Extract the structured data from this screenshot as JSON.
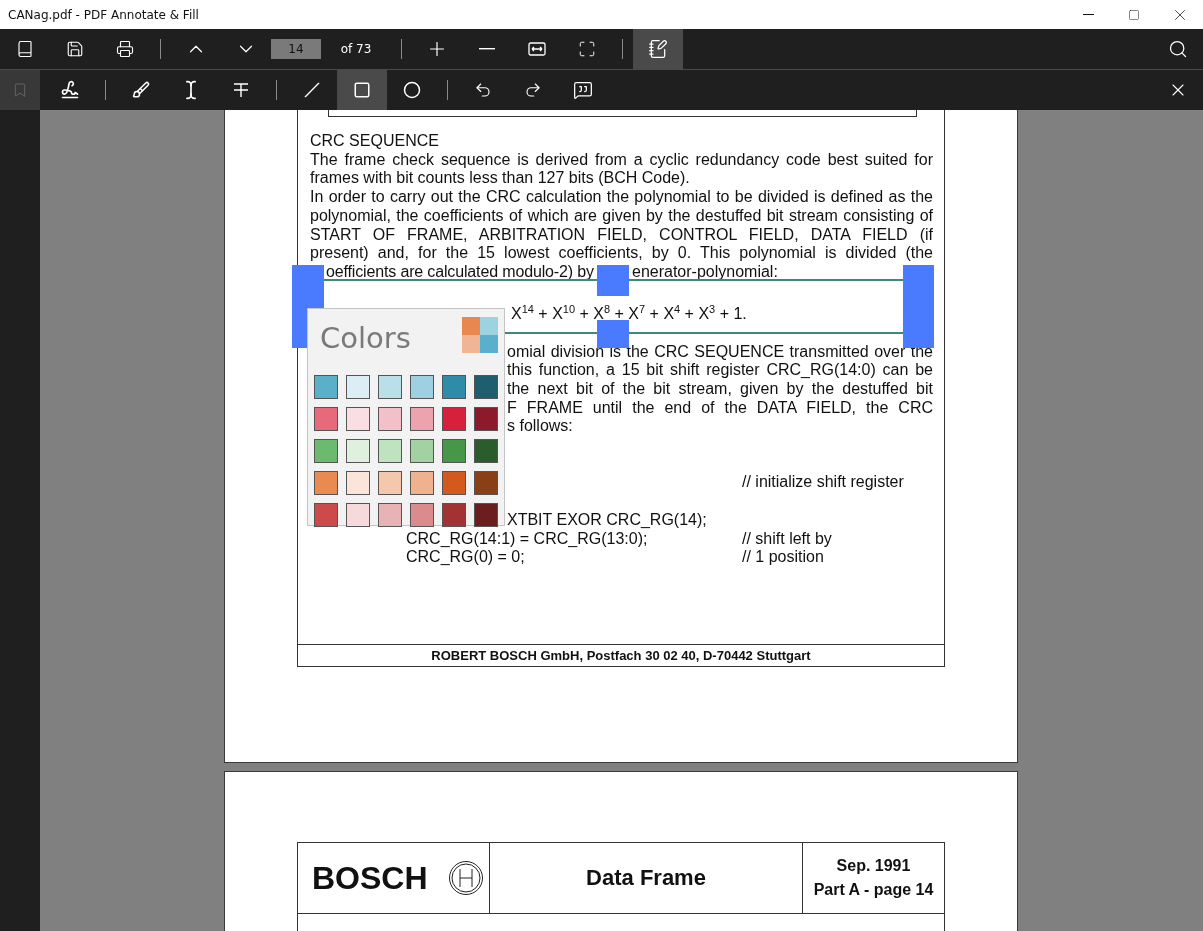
{
  "window": {
    "title": "CANag.pdf - PDF Annotate & Fill"
  },
  "toolbar": {
    "page_field": "14",
    "page_count": "of 73",
    "annotate_mode": {
      "selected": true
    }
  },
  "annotation_toolbar": {
    "bookmark": {
      "disabled": true
    },
    "tools": [
      {
        "selected": false
      },
      {
        "selected": false
      },
      {
        "selected": false
      },
      {
        "selected": false
      },
      {
        "selected": false
      },
      {
        "selected": true
      },
      {
        "selected": false
      }
    ]
  },
  "page_1": {
    "lines": [
      {
        "kind": "heading",
        "text": "CRC SEQUENCE"
      },
      {
        "kind": "line",
        "text": "The frame check sequence is derived from a cyclic redundancy code best suited for"
      },
      {
        "kind": "line_end",
        "text": "frames with bit counts less than 127 bits (BCH Code)."
      },
      {
        "kind": "line",
        "text": "In order to carry out the CRC calculation the polynomial to be divided is defined as the"
      },
      {
        "kind": "line",
        "text": "polynomial, the coefficients of which are given by the destuffed bit stream consisting of"
      },
      {
        "kind": "line",
        "text": "START OF FRAME, ARBITRATION FIELD, CONTROL FIELD, DATA FIELD (if"
      },
      {
        "kind": "line",
        "text": "present) and, for the 15 lowest coefficients, by 0. This polynomial is divided (the"
      },
      {
        "kind": "split",
        "parts": [
          "oefficients are calculated modulo-2) by",
          "enerator-polynomial:"
        ]
      },
      {
        "kind": "formula",
        "text": "X$^{14}$ + X$^{10}$ + X$^{8}$ + X$^{7}$ + X$^{4}$ + X$^{3}$ + 1."
      },
      {
        "kind": "clipped",
        "text": "omial division is the CRC SEQUENCE transmitted over the"
      },
      {
        "kind": "clipped",
        "text": "this function, a 15 bit shift register CRC_RG(14:0) can be"
      },
      {
        "kind": "clipped",
        "text": "the next bit of the bit stream, given by the destuffed bit"
      },
      {
        "kind": "clipped",
        "text": "F FRAME until the end of the DATA FIELD, the CRC"
      },
      {
        "kind": "clipped_end",
        "text": "s follows:"
      },
      {
        "kind": "comment",
        "text": "// initialize shift register"
      },
      {
        "kind": "clipped_end",
        "text": "XTBIT EXOR CRC_RG(14);"
      },
      {
        "kind": "code",
        "code": "CRC_RG(14:1) = CRC_RG(13:0);",
        "comment": "// shift left by"
      },
      {
        "kind": "code",
        "code": "CRC_RG(0) = 0;",
        "comment": "// 1 position"
      }
    ],
    "footer": "ROBERT BOSCH GmbH, Postfach 30 02 40, D-70442 Stuttgart"
  },
  "page_2": {
    "header": {
      "brand": "BOSCH",
      "title": "Data Frame",
      "date": "Sep. 1991",
      "page": "Part A - page 14"
    }
  },
  "colors_popup": {
    "title": "Colors",
    "rows": [
      {
        "swatches": [
          {
            "color": "#5aafc9"
          },
          {
            "color": "#dcedf3"
          },
          {
            "color": "#b9dfe9"
          },
          {
            "color": "#9ed0e1"
          },
          {
            "color": "#2f8ca8"
          },
          {
            "color": "#1f5e6e"
          }
        ]
      },
      {
        "swatches": [
          {
            "color": "#e66a7a"
          },
          {
            "color": "#f9dfe3"
          },
          {
            "color": "#f3bfc9"
          },
          {
            "color": "#eca3ad"
          },
          {
            "color": "#d7213b"
          },
          {
            "color": "#8d1a2a"
          }
        ]
      },
      {
        "swatches": [
          {
            "color": "#6cba6e"
          },
          {
            "color": "#e0f0de"
          },
          {
            "color": "#bfe2bf"
          },
          {
            "color": "#a2d2a2"
          },
          {
            "color": "#469848"
          },
          {
            "color": "#2a5c2c"
          }
        ]
      },
      {
        "swatches": [
          {
            "color": "#e98a51"
          },
          {
            "color": "#fbe4da"
          },
          {
            "color": "#f5c8ae"
          },
          {
            "color": "#efb18e"
          },
          {
            "color": "#d4591c"
          },
          {
            "color": "#8b3f16"
          }
        ]
      },
      {
        "swatches": [
          {
            "color": "#cc4a4a"
          },
          {
            "color": "#f5d9db"
          },
          {
            "color": "#e8b3b4"
          },
          {
            "color": "#dc8b8c"
          },
          {
            "color": "#a33233"
          },
          {
            "color": "#6c1e1f"
          }
        ]
      }
    ]
  }
}
